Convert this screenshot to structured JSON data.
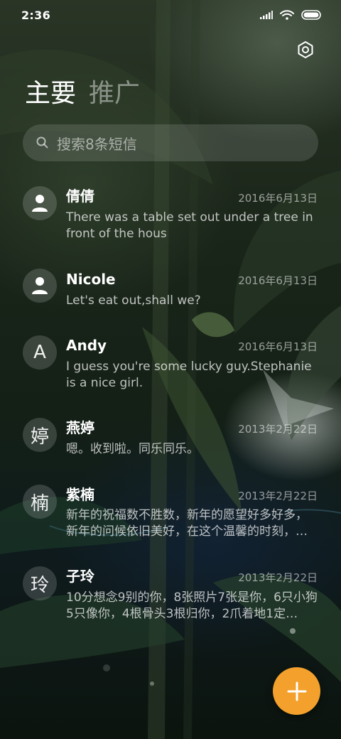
{
  "status_bar": {
    "time": "2:36",
    "icons": [
      "signal-icon",
      "wifi-icon",
      "battery-icon"
    ]
  },
  "header": {
    "settings_icon": "gear-icon",
    "tabs": [
      {
        "label": "主要",
        "active": true
      },
      {
        "label": "推广",
        "active": false
      }
    ]
  },
  "search": {
    "placeholder": "搜索8条短信",
    "icon": "search-icon"
  },
  "conversations": [
    {
      "avatar": "",
      "avatar_icon": "person-icon",
      "name": "倩倩",
      "date": "2016年6月13日",
      "snippet": "There was a table set out under a tree in front of the hous"
    },
    {
      "avatar": "",
      "avatar_icon": "person-icon",
      "name": "Nicole",
      "date": "2016年6月13日",
      "snippet": "Let's eat out,shall we?"
    },
    {
      "avatar": "A",
      "name": "Andy",
      "date": "2016年6月13日",
      "snippet": "I guess you're some lucky guy.Stephanie is a nice girl."
    },
    {
      "avatar": "婷",
      "name": "燕婷",
      "date": "2013年2月22日",
      "snippet": "嗯。收到啦。同乐同乐。"
    },
    {
      "avatar": "楠",
      "name": "紫楠",
      "date": "2013年2月22日",
      "snippet": "新年的祝福数不胜数，新年的愿望好多好多，新年的问候依旧美好，在这个温馨的时刻，…"
    },
    {
      "avatar": "玲",
      "name": "子玲",
      "date": "2013年2月22日",
      "snippet": "10分想念9别的你，8张照片7张是你，6只小狗5只像你，4根骨头3根归你，2爪着地1定…"
    }
  ],
  "fab": {
    "icon": "plus-icon"
  },
  "colors": {
    "accent": "#f3a12c"
  }
}
